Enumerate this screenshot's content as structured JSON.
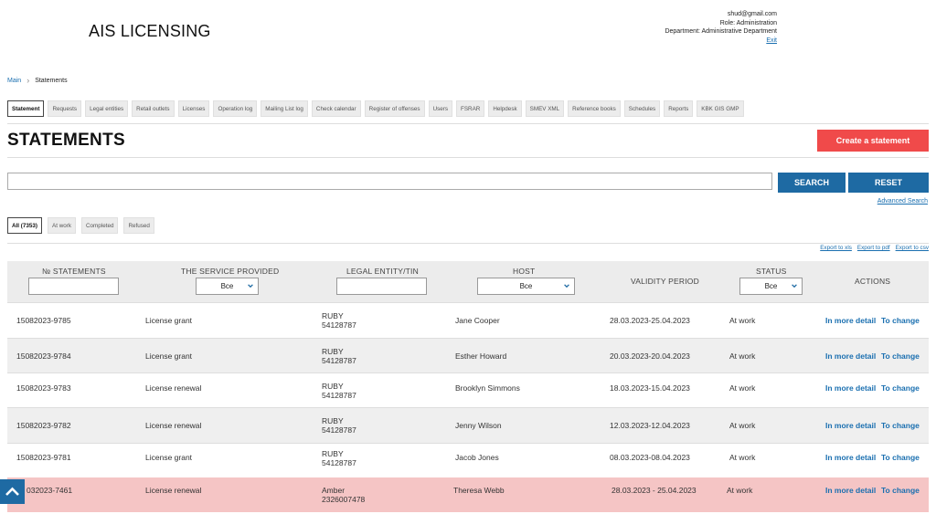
{
  "header": {
    "app_title": "AIS LICENSING",
    "user_email": "shud@gmail.com",
    "user_role": "Role: Administration",
    "user_department": "Department: Administrative Department",
    "exit_label": "Exit"
  },
  "breadcrumb": {
    "home": "Main",
    "current": "Statements"
  },
  "tabs": [
    "Statement",
    "Requests",
    "Legal entities",
    "Retail outlets",
    "Licenses",
    "Operation log",
    "Mailing List log",
    "Check calendar",
    "Register of offenses",
    "Users",
    "FSRAR",
    "Helpdesk",
    "SMEV XML",
    "Reference books",
    "Schedules",
    "Reports",
    "KBK GIS GMP"
  ],
  "page": {
    "title": "STATEMENTS",
    "create_label": "Create a statement"
  },
  "search": {
    "placeholder": "",
    "search_label": "SEARCH",
    "reset_label": "RESET",
    "advanced_label": "Advanced Search"
  },
  "filters": [
    "All (7353)",
    "At work",
    "Completed",
    "Refused"
  ],
  "exports": [
    "Export to xls",
    "Export to pdf",
    "Export to csv"
  ],
  "columns": {
    "number": "№ STATEMENTS",
    "service": "THE SERVICE PROVIDED",
    "entity": "LEGAL ENTITY/TIN",
    "host": "HOST",
    "validity": "VALIDITY PERIOD",
    "status": "STATUS",
    "actions": "ACTIONS",
    "service_filter": "Все",
    "host_filter": "Все",
    "status_filter": "Все"
  },
  "actions": {
    "detail": "In more detail",
    "change": "To change"
  },
  "rows": [
    {
      "number": "15082023-9785",
      "service": "License grant",
      "entity_name": "RUBY",
      "entity_tin": "54128787",
      "host": "Jane Cooper",
      "validity": "28.03.2023-25.04.2023",
      "status": "At work"
    },
    {
      "number": "15082023-9784",
      "service": "License grant",
      "entity_name": "RUBY",
      "entity_tin": "54128787",
      "host": "Esther Howard",
      "validity": "20.03.2023-20.04.2023",
      "status": "At work"
    },
    {
      "number": "15082023-9783",
      "service": "License renewal",
      "entity_name": "RUBY",
      "entity_tin": "54128787",
      "host": "Brooklyn Simmons",
      "validity": "18.03.2023-15.04.2023",
      "status": "At work"
    },
    {
      "number": "15082023-9782",
      "service": "License renewal",
      "entity_name": "RUBY",
      "entity_tin": "54128787",
      "host": "Jenny Wilson",
      "validity": "12.03.2023-12.04.2023",
      "status": "At work"
    },
    {
      "number": "15082023-9781",
      "service": "License grant",
      "entity_name": "RUBY",
      "entity_tin": "54128787",
      "host": "Jacob Jones",
      "validity": "08.03.2023-08.04.2023",
      "status": "At work"
    },
    {
      "number": "032023-7461",
      "service": "License renewal",
      "entity_name": "Amber",
      "entity_tin": "2326007478",
      "host": "Theresa Webb",
      "validity": "28.03.2023 - 25.04.2023",
      "status": "At work"
    }
  ],
  "colors": {
    "accent_blue": "#1e6aa3",
    "create_red": "#f04a4a",
    "highlight_row": "#f5c5c5",
    "link": "#1a6fb0"
  }
}
